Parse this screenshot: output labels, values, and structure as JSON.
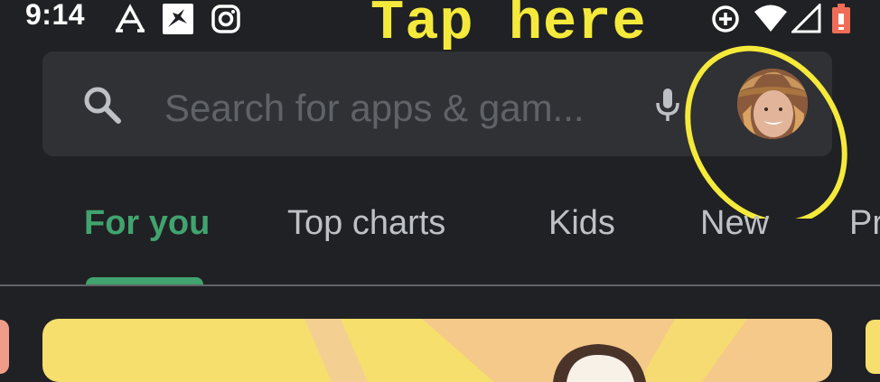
{
  "status_bar": {
    "time": "9:14",
    "icons": [
      "font-a-icon",
      "nike-icon",
      "instagram-icon",
      "data-saver-icon",
      "wifi-icon",
      "signal-icon",
      "battery-icon"
    ]
  },
  "annotation": {
    "text": "Tap here",
    "color": "#f5ea3b"
  },
  "search": {
    "placeholder": "Search for apps & gam...",
    "icon": "search-icon",
    "mic_icon": "mic-icon"
  },
  "account": {
    "avatar": "profile-avatar"
  },
  "tabs": [
    {
      "label": "For you",
      "active": true
    },
    {
      "label": "Top charts",
      "active": false
    },
    {
      "label": "Kids",
      "active": false
    },
    {
      "label": "New",
      "active": false
    },
    {
      "label": "Pr",
      "active": false
    }
  ],
  "colors": {
    "background": "#202124",
    "search_bg": "#303134",
    "accent": "#41a36e",
    "tab_text": "#bdc1c6",
    "card": "#f6df6d"
  }
}
